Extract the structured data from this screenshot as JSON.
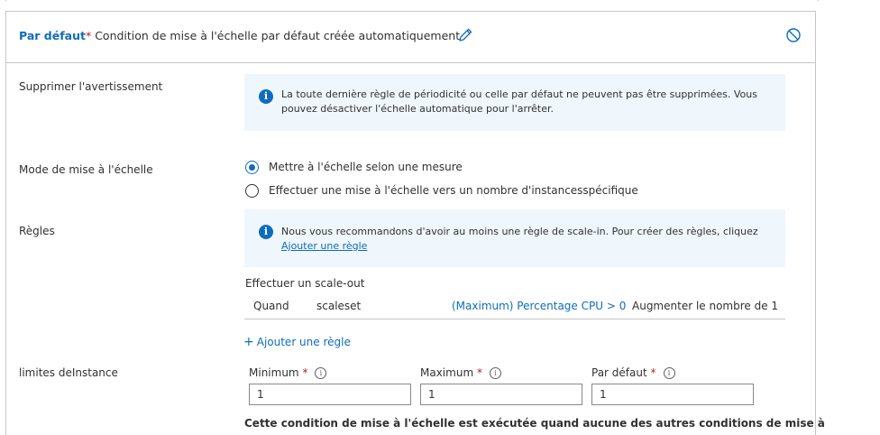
{
  "header": {
    "default_label": "Par défaut",
    "required_mark": "*",
    "condition_text": "Condition de mise à l'échelle par défaut créée automatiquement"
  },
  "delete_warning": {
    "label": "Supprimer l'avertissement",
    "info_line1": "La toute dernière règle de périodicité ou celle par défaut ne peuvent pas être supprimées. Vous",
    "info_line2": "pouvez désactiver l'échelle automatique pour l'arrêter."
  },
  "scale_mode": {
    "label": "Mode de mise à l'échelle",
    "options": [
      {
        "label": "Mettre à l'échelle selon une mesure",
        "checked": true
      },
      {
        "label": "Effectuer une mise à l'échelle vers un nombre d'instancesspécifique",
        "checked": false
      }
    ]
  },
  "rules": {
    "label": "Règles",
    "info_line1": "Nous vous recommandons d'avoir au moins une règle de scale-in. Pour créer des règles, cliquez",
    "info_link": "Ajouter une règle",
    "scale_out_heading": "Effectuer un scale-out",
    "row": {
      "when": "Quand",
      "resource": "scaleset",
      "condition": "(Maximum) Percentage CPU > 0",
      "action": "Augmenter le nombre de 1"
    },
    "add_rule": "Ajouter une règle"
  },
  "limits": {
    "label": "limites deInstance",
    "fields": [
      {
        "label": "Minimum",
        "value": "1"
      },
      {
        "label": "Maximum",
        "value": "1"
      },
      {
        "label": "Par défaut",
        "value": "1"
      }
    ]
  },
  "footer_cutoff": "Cette condition de mise à l'échelle est exécutée quand aucune des autres conditions de mise à"
}
